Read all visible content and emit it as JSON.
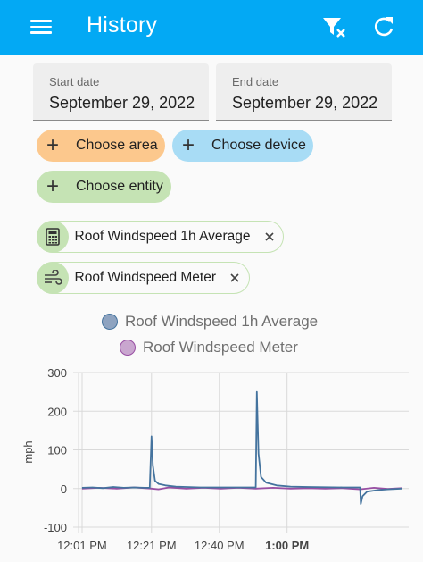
{
  "header": {
    "title": "History",
    "menu_icon": "menu-icon",
    "filter_icon": "filter-remove-icon",
    "refresh_icon": "refresh-icon"
  },
  "colors": {
    "header": "#03a9f4",
    "area_chip": "#fcc88d",
    "device_chip": "#a8dcf5",
    "entity_chip": "#c5e3b4",
    "series1": "#44739e",
    "series2": "#984ea3"
  },
  "dates": {
    "start": {
      "label": "Start date",
      "value": "September 29, 2022"
    },
    "end": {
      "label": "End date",
      "value": "September 29, 2022"
    }
  },
  "targets": {
    "area": "Choose area",
    "device": "Choose device",
    "entity": "Choose entity",
    "plus": "+"
  },
  "entities": [
    {
      "name": "Roof Windspeed 1h Average",
      "icon": "calculator-icon"
    },
    {
      "name": "Roof Windspeed Meter",
      "icon": "wind-icon"
    }
  ],
  "chart_data": {
    "type": "line",
    "ylabel": "mph",
    "ylim": [
      -100,
      300
    ],
    "yticks": [
      300,
      200,
      100,
      0,
      -100
    ],
    "xticks": [
      {
        "label": "12:01 PM",
        "bold": false
      },
      {
        "label": "12:21 PM",
        "bold": false
      },
      {
        "label": "12:40 PM",
        "bold": false
      },
      {
        "label": "1:00 PM",
        "bold": true
      }
    ],
    "x_unit": "minutes since 12:00 PM",
    "xlim": [
      -1,
      94
    ],
    "grid": true,
    "legend_position": "top",
    "series": [
      {
        "name": "Roof Windspeed 1h Average",
        "color": "#44739e",
        "points": [
          [
            0,
            2
          ],
          [
            3,
            3
          ],
          [
            6,
            1
          ],
          [
            9,
            4
          ],
          [
            12,
            2
          ],
          [
            15,
            3
          ],
          [
            18,
            2
          ],
          [
            19.5,
            2
          ],
          [
            20,
            135
          ],
          [
            20.4,
            60
          ],
          [
            21,
            20
          ],
          [
            22,
            12
          ],
          [
            24,
            8
          ],
          [
            27,
            5
          ],
          [
            30,
            4
          ],
          [
            34,
            3
          ],
          [
            40,
            3
          ],
          [
            45,
            3
          ],
          [
            49,
            3
          ],
          [
            50,
            3
          ],
          [
            50.3,
            250
          ],
          [
            50.8,
            90
          ],
          [
            51.5,
            30
          ],
          [
            53,
            15
          ],
          [
            56,
            8
          ],
          [
            60,
            5
          ],
          [
            65,
            4
          ],
          [
            75,
            3
          ],
          [
            80,
            3
          ],
          [
            80,
            2
          ],
          [
            80.2,
            -40
          ],
          [
            80.7,
            -20
          ],
          [
            82,
            -8
          ],
          [
            85,
            -4
          ],
          [
            88,
            -2
          ],
          [
            92,
            0
          ]
        ]
      },
      {
        "name": "Roof Windspeed Meter",
        "color": "#984ea3",
        "points": [
          [
            0,
            0
          ],
          [
            5,
            2
          ],
          [
            10,
            0
          ],
          [
            15,
            3
          ],
          [
            20,
            0
          ],
          [
            22,
            -2
          ],
          [
            25,
            3
          ],
          [
            30,
            0
          ],
          [
            35,
            2
          ],
          [
            40,
            0
          ],
          [
            45,
            2
          ],
          [
            50,
            0
          ],
          [
            55,
            2
          ],
          [
            60,
            0
          ],
          [
            65,
            1
          ],
          [
            70,
            0
          ],
          [
            75,
            1
          ],
          [
            80,
            -2
          ],
          [
            84,
            2
          ],
          [
            88,
            -1
          ],
          [
            92,
            1
          ]
        ]
      }
    ]
  }
}
